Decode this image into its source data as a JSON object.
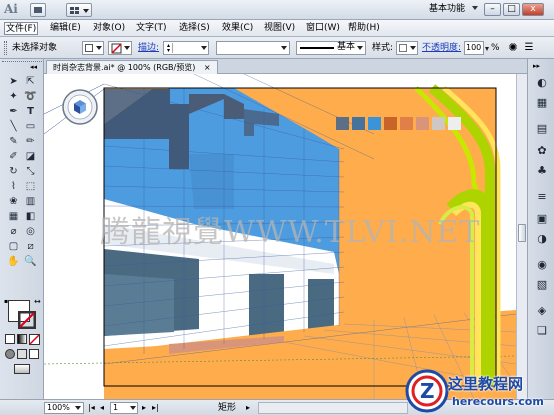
{
  "app": {
    "logo": "Ai"
  },
  "titlebar": {
    "workspace": "基本功能",
    "window_buttons": {
      "minimize": "–",
      "restore": "□",
      "close": "x"
    }
  },
  "menubar": {
    "items": [
      "文件(F)",
      "编辑(E)",
      "对象(O)",
      "文字(T)",
      "选择(S)",
      "效果(C)",
      "视图(V)",
      "窗口(W)",
      "帮助(H)"
    ]
  },
  "controlbar": {
    "selection_state": "未选择对象",
    "stroke_label": "描边:",
    "style_preset": "基本",
    "style_label": "样式:",
    "opacity_label": "不透明度:",
    "opacity_value": "100",
    "opacity_unit": "%"
  },
  "document": {
    "tab_title": "时尚杂志背景.ai* @ 100% (RGB/预览)",
    "watermark": "腾龍視覺WWW.TLVI.NET"
  },
  "artwork": {
    "palette": [
      "#5d6f86",
      "#46729c",
      "#3b93d8",
      "#c8642a",
      "#e17f48",
      "#d9957a",
      "#cfc7c4",
      "#eeeeee"
    ],
    "colors": {
      "sky": "#ffac4d",
      "facade": "#4d9ce0",
      "dark": "#425a79",
      "white": "#ffffff",
      "ground": "#4a6a82",
      "neon_green": "#aed400",
      "neon_yellow": "#ffe45c"
    }
  },
  "statusbar": {
    "zoom": "100%",
    "page": "1",
    "tool_name": "矩形"
  },
  "badge": {
    "title": "这里教程网",
    "url": "herecours.com"
  },
  "icons": [
    "selection-icon",
    "direct-selection-icon",
    "magic-wand-icon",
    "lasso-icon",
    "pen-icon",
    "type-icon",
    "line-icon",
    "rectangle-icon",
    "paintbrush-icon",
    "pencil-icon",
    "blob-brush-icon",
    "eraser-icon",
    "rotate-icon",
    "scale-icon",
    "warp-icon",
    "free-transform-icon",
    "symbol-sprayer-icon",
    "graph-icon",
    "mesh-icon",
    "gradient-icon",
    "eyedropper-icon",
    "blend-icon",
    "artboard-icon",
    "slice-icon",
    "hand-icon",
    "zoom-icon"
  ]
}
